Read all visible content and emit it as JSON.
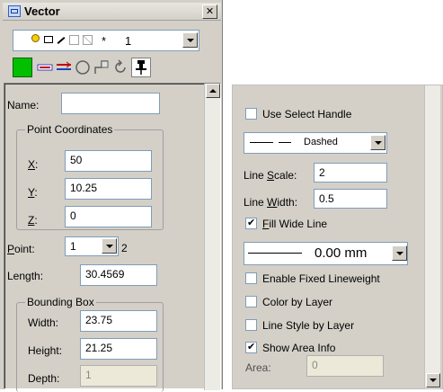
{
  "window": {
    "title": "Vector",
    "close_glyph": "✕"
  },
  "toolbar": {
    "layer_selector": {
      "star": "*",
      "number": "1"
    },
    "tool_icons": [
      "fill-color-swatch",
      "line-color-icon",
      "line-style-icon",
      "circle-icon",
      "transform-icon",
      "rotate-icon",
      "pin-icon"
    ],
    "fill_color": "#00c000"
  },
  "left": {
    "name_label": "Name:",
    "name_value": "",
    "point_coords_title": "Point Coordinates",
    "x_label": "X:",
    "x_value": "50",
    "y_label": "Y:",
    "y_value": "10.25",
    "z_label": "Z:",
    "z_value": "0",
    "point_label": "Point:",
    "point_value": "1",
    "point_count": "2",
    "length_label": "Length:",
    "length_value": "30.4569",
    "bounding_title": "Bounding Box",
    "width_label": "Width:",
    "width_value": "23.75",
    "height_label": "Height:",
    "height_value": "21.25",
    "depth_label": "Depth:",
    "depth_value": "1"
  },
  "right": {
    "use_select_handle": "Use Select Handle",
    "line_style_value": "Dashed",
    "line_scale_label": "Line Scale:",
    "line_scale_value": "2",
    "line_width_label": "Line Width:",
    "line_width_value": "0.5",
    "fill_wide_line": "Fill Wide Line",
    "lineweight_value": "0.00 mm",
    "enable_fixed_lineweight": "Enable Fixed Lineweight",
    "color_by_layer": "Color by Layer",
    "line_style_by_layer": "Line Style by Layer",
    "show_area_info": "Show Area Info",
    "area_label": "Area:",
    "area_value": "0"
  },
  "checkbox_states": {
    "use_select_handle": false,
    "fill_wide_line": true,
    "enable_fixed_lineweight": false,
    "color_by_layer": false,
    "line_style_by_layer": false,
    "show_area_info": true
  }
}
